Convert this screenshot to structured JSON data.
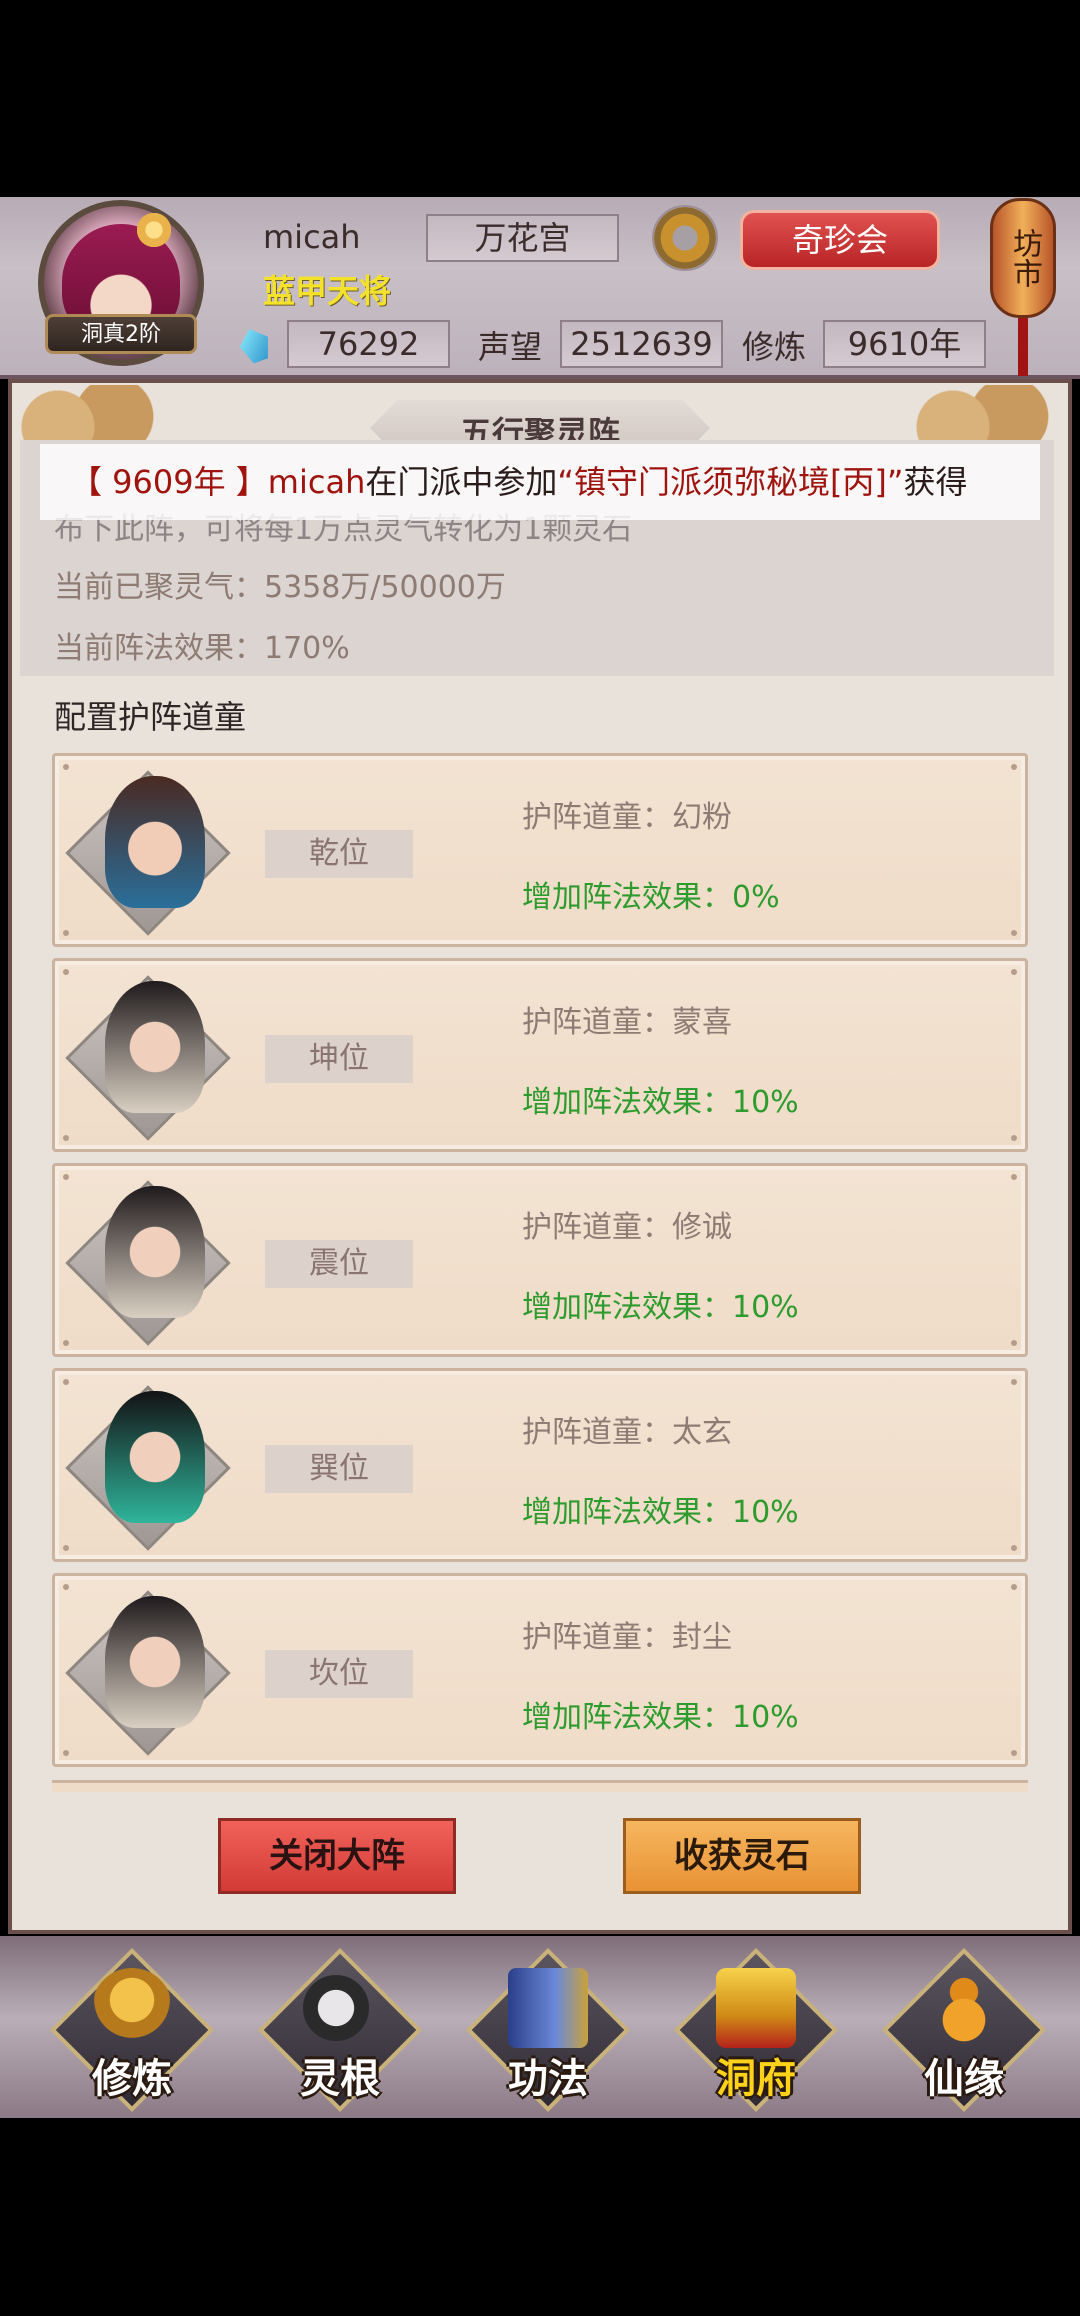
{
  "header": {
    "rank_badge": "洞真2阶",
    "player_name": "micah",
    "player_title": "蓝甲天将",
    "sect": "万花宫",
    "treasure_button": "奇珍会",
    "market_lantern": "坊市",
    "spirit_stones": "76292",
    "prestige_label": "声望",
    "prestige_value": "2512639",
    "cultivation_label": "修炼",
    "cultivation_value": "9610年"
  },
  "panel": {
    "title": "五行聚灵阵",
    "info_line1": "布下此阵，可将每1万点灵气转化为1颗灵石",
    "info_line2": "当前已聚灵气：5358万/50000万",
    "info_line3": "当前阵法效果：170%",
    "config_label": "配置护阵道童"
  },
  "marquee": {
    "year": "【 9609年 】",
    "name": "micah",
    "text1": "在门派中参加",
    "event": "“镇守门派须弥秘境[丙]”",
    "text2": "获得"
  },
  "guardians": [
    {
      "position": "乾位",
      "guardian": "护阵道童：幻粉",
      "bonus": "增加阵法效果：0%"
    },
    {
      "position": "坤位",
      "guardian": "护阵道童：蒙喜",
      "bonus": "增加阵法效果：10%"
    },
    {
      "position": "震位",
      "guardian": "护阵道童：修诚",
      "bonus": "增加阵法效果：10%"
    },
    {
      "position": "巽位",
      "guardian": "护阵道童：太玄",
      "bonus": "增加阵法效果：10%"
    },
    {
      "position": "坎位",
      "guardian": "护阵道童：封尘",
      "bonus": "增加阵法效果：10%"
    }
  ],
  "buttons": {
    "close": "关闭大阵",
    "harvest": "收获灵石"
  },
  "bottom_nav": [
    {
      "label": "修炼",
      "icon": "monk-icon"
    },
    {
      "label": "灵根",
      "icon": "spirit-root-icon"
    },
    {
      "label": "功法",
      "icon": "scripture-book-icon"
    },
    {
      "label": "洞府",
      "icon": "cave-palace-icon",
      "active": true
    },
    {
      "label": "仙缘",
      "icon": "gourd-icon"
    }
  ],
  "colors": {
    "bonus_green": "#2e9b2e",
    "marquee_red": "#a0140f",
    "active_nav": "#ffd21a",
    "title_yellow": "#f4e22a"
  }
}
